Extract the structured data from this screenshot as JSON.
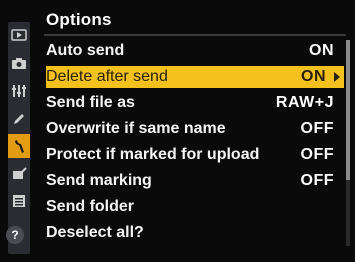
{
  "menu": {
    "title": "Options",
    "items": [
      {
        "label": "Auto send",
        "value": "ON"
      },
      {
        "label": "Delete after send",
        "value": "ON"
      },
      {
        "label": "Send file as",
        "value": "RAW+J"
      },
      {
        "label": "Overwrite if same name",
        "value": "OFF"
      },
      {
        "label": "Protect if marked for upload",
        "value": "OFF"
      },
      {
        "label": "Send marking",
        "value": "OFF"
      },
      {
        "label": "Send folder",
        "value": ""
      },
      {
        "label": "Deselect all?",
        "value": ""
      }
    ]
  },
  "sidebar": {
    "icons": [
      "playback-icon",
      "camera-icon",
      "custom-settings-icon",
      "pencil-icon",
      "wrench-icon",
      "retouch-icon",
      "my-menu-icon"
    ],
    "help": "?"
  },
  "colors": {
    "highlight": "#f2c11e",
    "active_tab": "#e39b12",
    "background": "#0a0a0a"
  }
}
